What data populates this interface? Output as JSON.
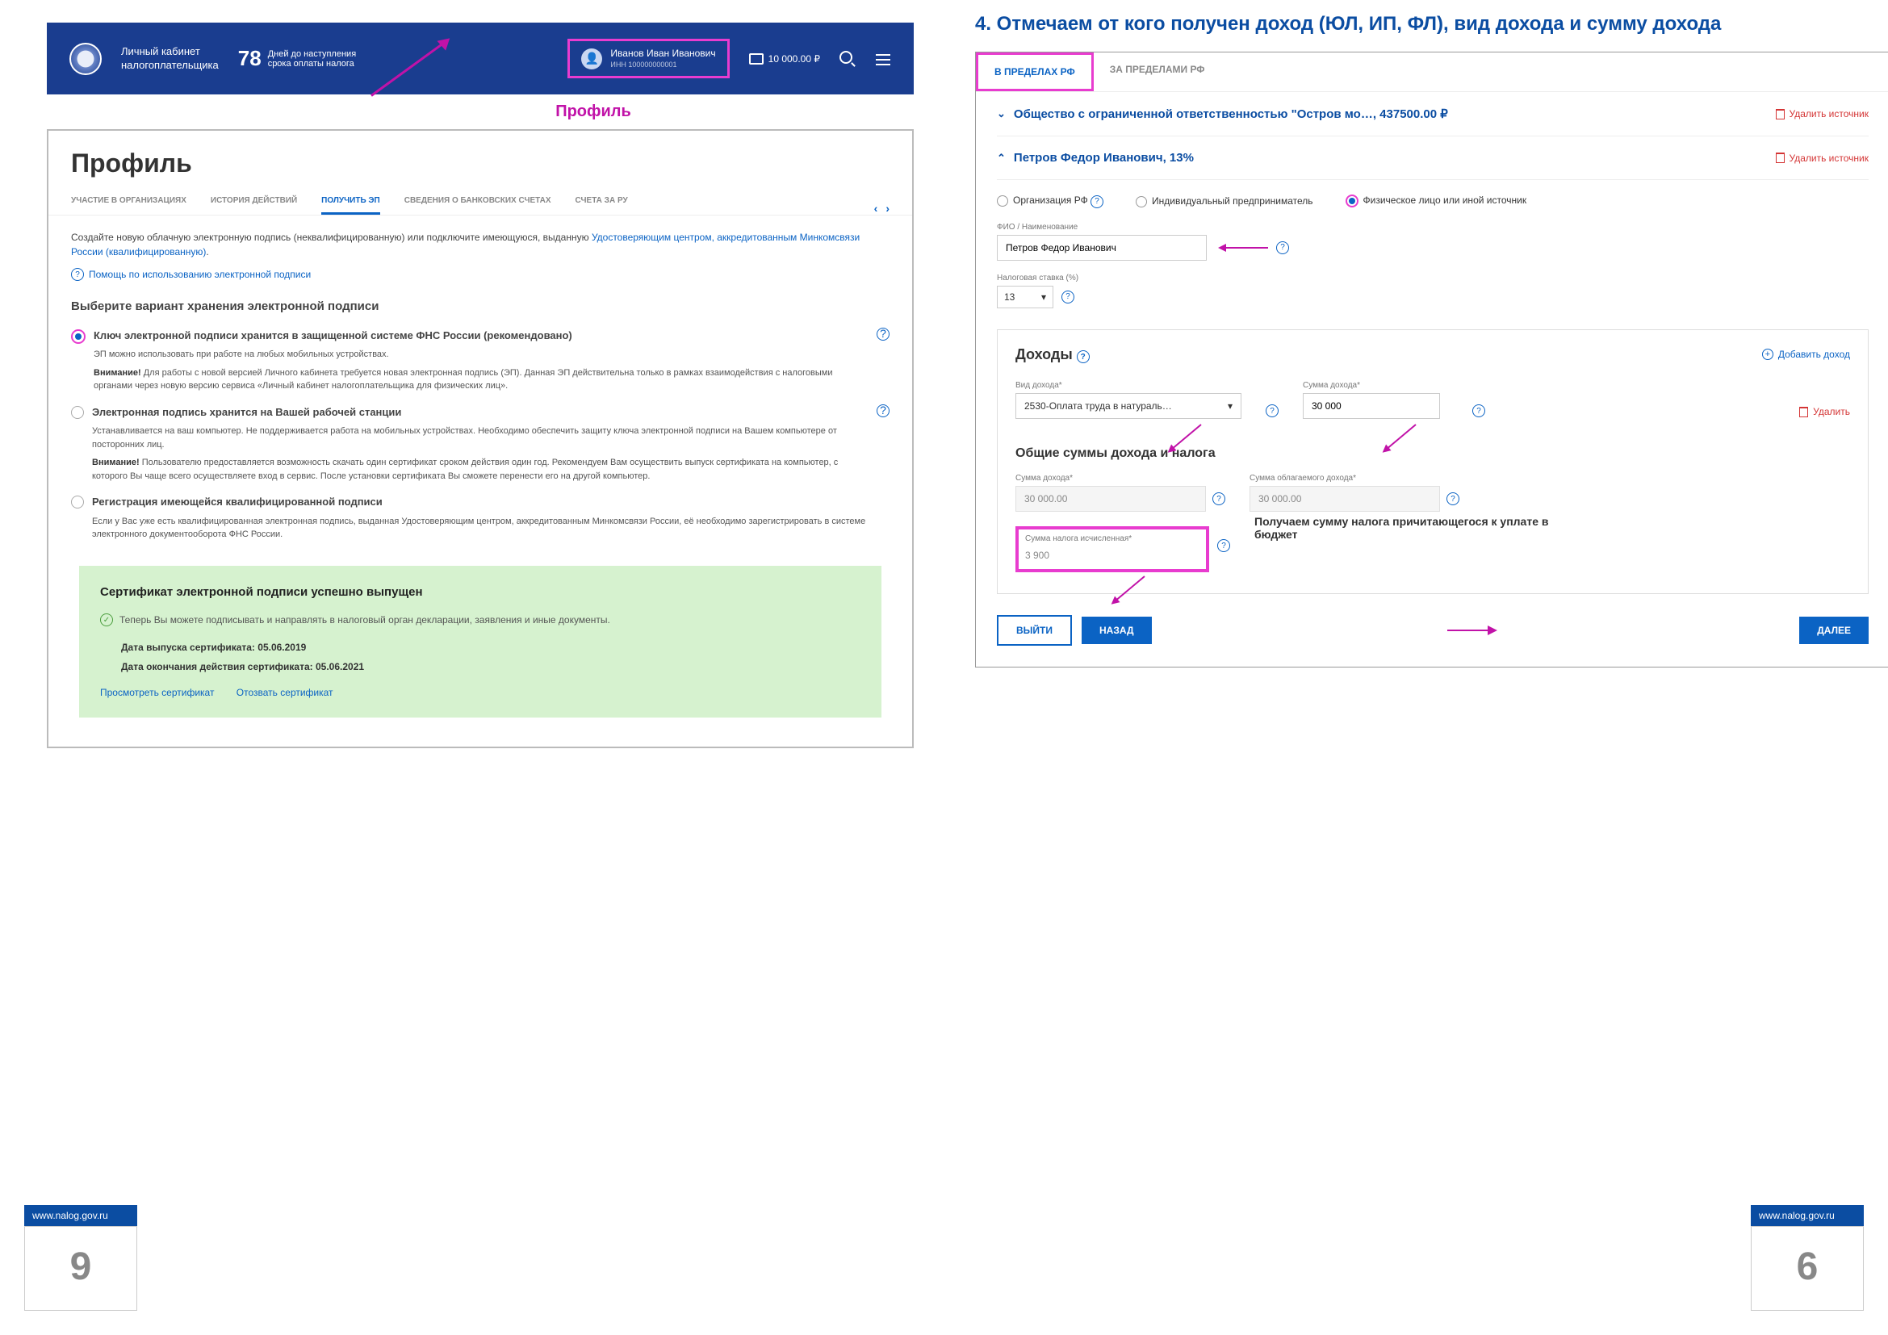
{
  "left": {
    "header": {
      "app_line1": "Личный кабинет",
      "app_line2": "налогоплательщика",
      "days": "78",
      "days_caption_line1": "Дней до наступления",
      "days_caption_line2": "срока оплаты налога",
      "user_name": "Иванов Иван Иванович",
      "user_inn_label": "ИНН 100000000001",
      "wallet": "10 000.00 ₽"
    },
    "profile_label": "Профиль",
    "profile_h1": "Профиль",
    "tabs": {
      "t1": "УЧАСТИЕ В ОРГАНИЗАЦИЯХ",
      "t2": "ИСТОРИЯ ДЕЙСТВИЙ",
      "t3": "ПОЛУЧИТЬ ЭП",
      "t4": "СВЕДЕНИЯ О БАНКОВСКИХ СЧЕТАХ",
      "t5": "СЧЕТА ЗА РУ"
    },
    "intro_text": "Создайте новую облачную электронную подпись (неквалифицированную) или подключите имеющуюся, выданную ",
    "intro_link": "Удостоверяющим центром, аккредитованным Минкомсвязи России (квалифицированную)",
    "help_link": "Помощь по использованию электронной подписи",
    "choose_h": "Выберите вариант хранения электронной подписи",
    "opt1": {
      "title": "Ключ электронной подписи хранится в защищенной системе ФНС России (рекомендовано)",
      "desc": "ЭП можно использовать при работе на любых мобильных устройствах.",
      "warn_b": "Внимание!",
      "warn": " Для работы с новой версией Личного кабинета требуется новая электронная подпись (ЭП). Данная ЭП действительна только в рамках взаимодействия с налоговыми органами через новую версию сервиса «Личный кабинет налогоплательщика для физических лиц»."
    },
    "opt2": {
      "title": "Электронная подпись хранится на Вашей рабочей станции",
      "desc": "Устанавливается на ваш компьютер. Не поддерживается работа на мобильных устройствах. Необходимо обеспечить защиту ключа электронной подписи на Вашем компьютере от посторонних лиц.",
      "warn_b": "Внимание!",
      "warn": " Пользователю предоставляется возможность скачать один сертификат сроком действия один год. Рекомендуем Вам осуществить выпуск сертификата на компьютер, с которого Вы чаще всего осуществляете вход в сервис. После установки сертификата Вы сможете перенести его на другой компьютер."
    },
    "opt3": {
      "title": "Регистрация имеющейся квалифицированной подписи",
      "desc": "Если у Вас уже есть квалифицированная электронная подпись, выданная Удостоверяющим центром, аккредитованным Минкомсвязи России, её необходимо зарегистрировать в системе электронного документооборота ФНС России."
    },
    "success": {
      "title": "Сертификат электронной подписи успешно выпущен",
      "info": "Теперь Вы можете подписывать и направлять в налоговый орган декларации, заявления и иные документы.",
      "date1_label": "Дата выпуска сертификата: ",
      "date1": "05.06.2019",
      "date2_label": "Дата окончания действия сертификата: ",
      "date2": "05.06.2021",
      "link1": "Просмотреть сертификат",
      "link2": "Отозвать сертификат"
    }
  },
  "right": {
    "heading": "4. Отмечаем от кого получен доход (ЮЛ, ИП, ФЛ), вид дохода и сумму дохода",
    "loc_tab1": "В ПРЕДЕЛАХ РФ",
    "loc_tab2": "ЗА ПРЕДЕЛАМИ РФ",
    "acc1_title": "Общество с ограниченной ответственностью \"Остров мо…, 437500.00 ₽",
    "acc2_title": "Петров Федор Иванович, 13%",
    "delete_src": "Удалить источник",
    "src_radios": {
      "r1": "Организация РФ",
      "r2": "Индивидуальный предприниматель",
      "r3": "Физическое лицо или иной источник"
    },
    "fio_label": "ФИО / Наименование",
    "fio_value": "Петров Федор Иванович",
    "rate_label": "Налоговая ставка (%)",
    "rate_value": "13",
    "income_h": "Доходы",
    "add_income": "Добавить доход",
    "kind_label": "Вид дохода*",
    "kind_value": "2530-Оплата труда в натураль…",
    "sum_label": "Сумма дохода*",
    "sum_value": "30 000",
    "delete_row": "Удалить",
    "totals_h": "Общие суммы дохода и налога",
    "total_income_label": "Сумма дохода*",
    "total_income": "30 000.00",
    "taxable_label": "Сумма облагаемого дохода*",
    "taxable": "30 000.00",
    "tax_calc_label": "Сумма налога исчисленная*",
    "tax_calc": "3 900",
    "calc_note": "Получаем сумму налога причитающегося к уплате в бюджет",
    "btn_exit": "ВЫЙТИ",
    "btn_back": "НАЗАД",
    "btn_next": "ДАЛЕЕ"
  },
  "footer": {
    "url": "www.nalog.gov.ru",
    "page_left": "9",
    "page_right": "6"
  }
}
